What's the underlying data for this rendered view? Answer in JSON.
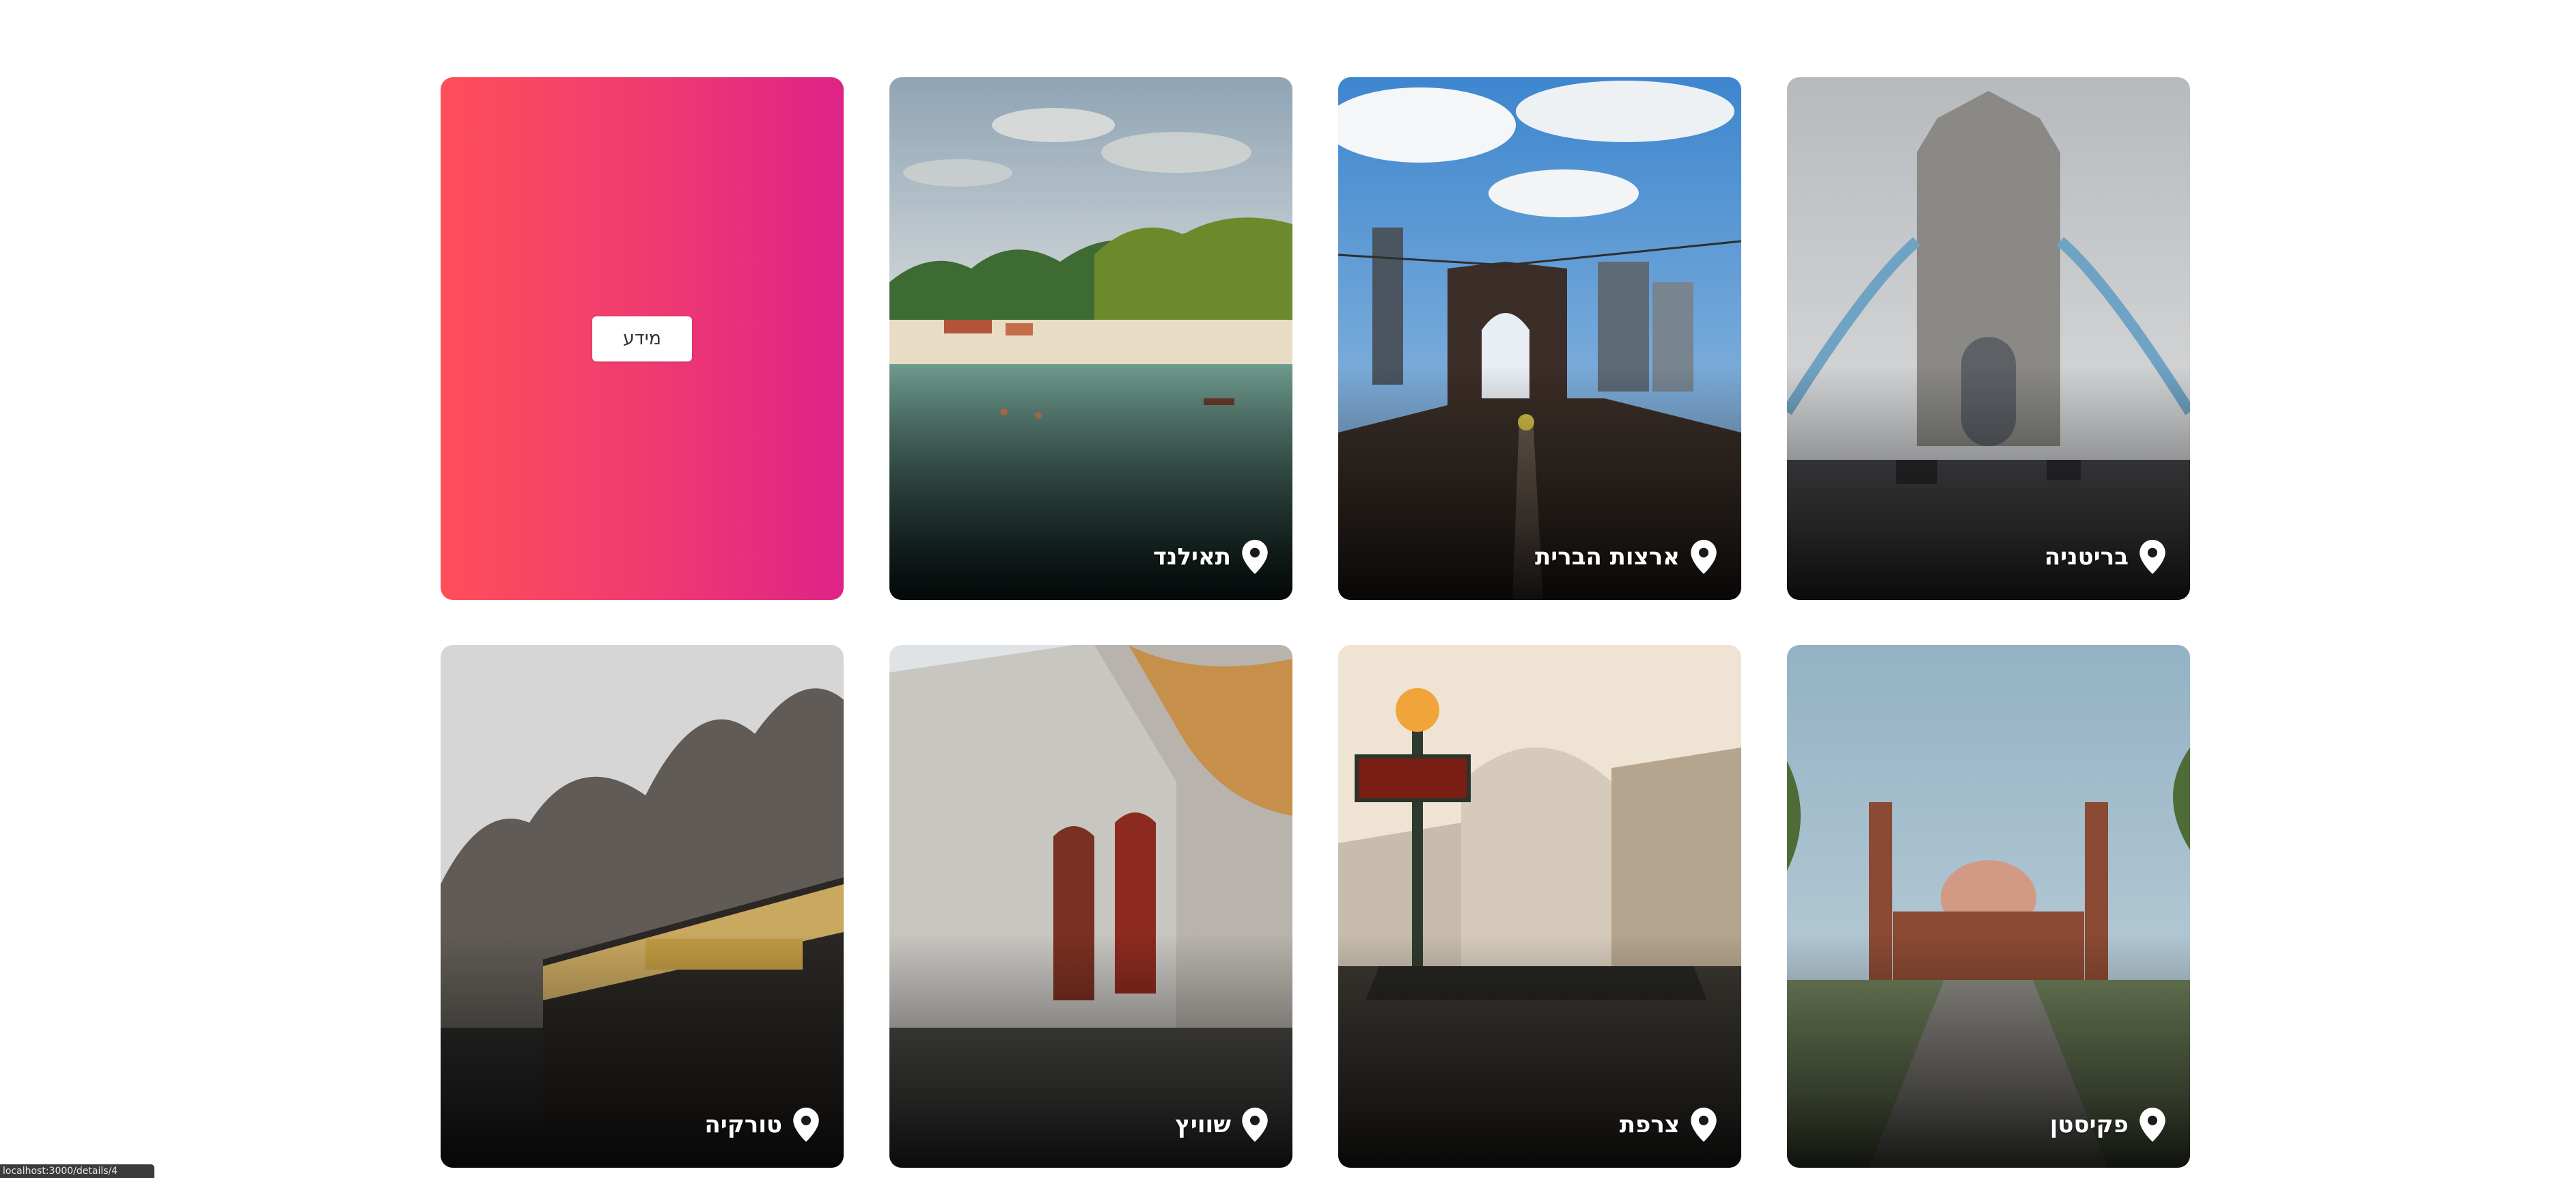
{
  "info_card": {
    "button_label": "מידע"
  },
  "destinations": [
    {
      "key": "britain",
      "label": "בריטניה"
    },
    {
      "key": "usa",
      "label": "ארצות הברית"
    },
    {
      "key": "thailand",
      "label": "תאילנד"
    },
    {
      "key": "pakistan",
      "label": "פקיסטן"
    },
    {
      "key": "france",
      "label": "צרפת"
    },
    {
      "key": "switzerland",
      "label": "שוויץ"
    },
    {
      "key": "turkey",
      "label": "טורקיה"
    }
  ],
  "status_bar": {
    "url": "localhost:3000/details/4"
  },
  "colors": {
    "info_gradient_start": "#ff4e59",
    "info_gradient_end": "#de2387",
    "label_text": "#ffffff"
  },
  "icons": {
    "location": "map-pin-icon"
  }
}
